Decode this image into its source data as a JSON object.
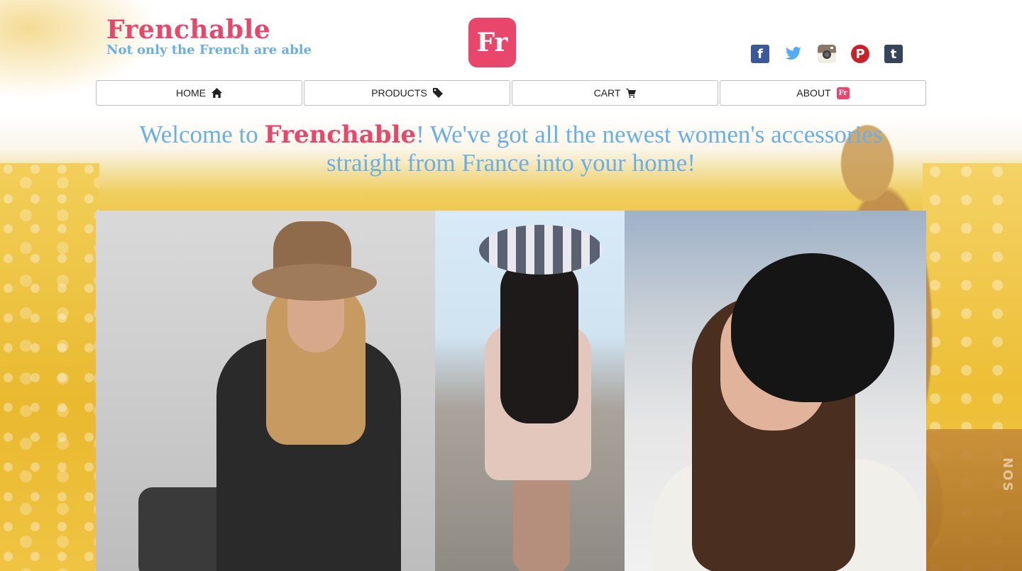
{
  "header": {
    "brand_title": "Frenchable",
    "tagline": "Not only the French are able",
    "logo_text": "Fr"
  },
  "socials": [
    {
      "name": "facebook",
      "icon": "facebook-icon",
      "glyph": "f",
      "color": "#3b5998"
    },
    {
      "name": "twitter",
      "icon": "twitter-icon",
      "glyph": "",
      "color": "#55acee"
    },
    {
      "name": "instagram",
      "icon": "instagram-icon",
      "glyph": "",
      "color": "#8a7664"
    },
    {
      "name": "pinterest",
      "icon": "pinterest-icon",
      "glyph": "P",
      "color": "#cb2027"
    },
    {
      "name": "tumblr",
      "icon": "tumblr-icon",
      "glyph": "t",
      "color": "#35465c"
    }
  ],
  "nav": {
    "home_label": "HOME",
    "products_label": "PRODUCTS",
    "cart_label": "CART",
    "about_label": "ABOUT",
    "about_badge": "Fr"
  },
  "welcome": {
    "prefix": "Welcome to ",
    "brand": "Frenchable",
    "line1_rest": "! We've got all the newest women's accessories",
    "line2": "straight from France into your home!"
  },
  "gallery": [
    {
      "name": "photo-fedora-leather-jacket"
    },
    {
      "name": "photo-striped-sun-hat"
    },
    {
      "name": "photo-black-beanie"
    }
  ],
  "background_decor": {
    "suitcase_stamp": "NOS"
  },
  "colors": {
    "brand_pink": "#e9466b",
    "brand_blue": "#6aaeea",
    "nav_border": "#bdbdbd"
  }
}
